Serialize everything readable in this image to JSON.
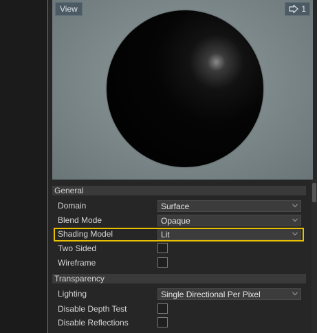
{
  "viewport": {
    "view_label": "View",
    "camera_count": "1"
  },
  "sections": {
    "general": "General",
    "transparency": "Transparency"
  },
  "properties": {
    "domain": {
      "label": "Domain",
      "value": "Surface"
    },
    "blend_mode": {
      "label": "Blend Mode",
      "value": "Opaque"
    },
    "shading_model": {
      "label": "Shading Model",
      "value": "Lit"
    },
    "two_sided": {
      "label": "Two Sided",
      "checked": false
    },
    "wireframe": {
      "label": "Wireframe",
      "checked": false
    },
    "lighting": {
      "label": "Lighting",
      "value": "Single Directional Per Pixel"
    },
    "disable_depth_test": {
      "label": "Disable Depth Test",
      "checked": false
    },
    "disable_reflections": {
      "label": "Disable Reflections",
      "checked": false
    }
  },
  "colors": {
    "highlight": "#e8c000",
    "accent_blue": "#3e7fcf"
  }
}
